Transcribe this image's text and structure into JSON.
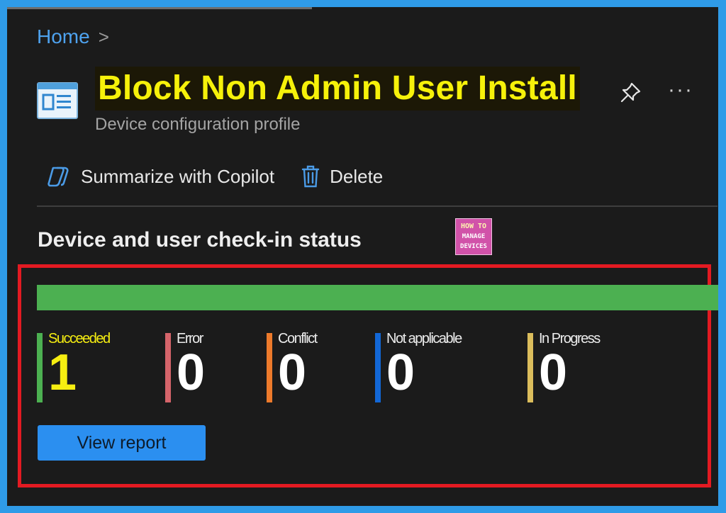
{
  "breadcrumb": {
    "home": "Home",
    "separator": ">"
  },
  "header": {
    "title": "Block Non Admin User Install",
    "subtitle": "Device configuration profile",
    "more_label": "···"
  },
  "toolbar": {
    "copilot_label": "Summarize with Copilot",
    "delete_label": "Delete"
  },
  "section": {
    "title": "Device and user check-in status"
  },
  "logo": {
    "line1": "HOW TO",
    "line2": "MANAGE",
    "line3": "DEVICES"
  },
  "status": {
    "succeeded_fraction": 1.0,
    "metrics": [
      {
        "label": "Succeeded",
        "count": "1",
        "color": "#4cb051"
      },
      {
        "label": "Error",
        "count": "0",
        "color": "#d5646a"
      },
      {
        "label": "Conflict",
        "count": "0",
        "color": "#ed7a2b"
      },
      {
        "label": "Not applicable",
        "count": "0",
        "color": "#1267d6"
      },
      {
        "label": "In Progress",
        "count": "0",
        "color": "#dbbd5c"
      }
    ],
    "view_report_label": "View report"
  },
  "colors": {
    "accent": "#2b8ff0",
    "title_highlight": "#f6f10a",
    "outline": "#e31a22",
    "page_border": "#2f9be8"
  },
  "icons": {
    "page": "device-configuration-icon",
    "pin": "pin-icon",
    "copilot": "copilot-icon",
    "delete": "trash-icon",
    "more": "more-icon"
  }
}
